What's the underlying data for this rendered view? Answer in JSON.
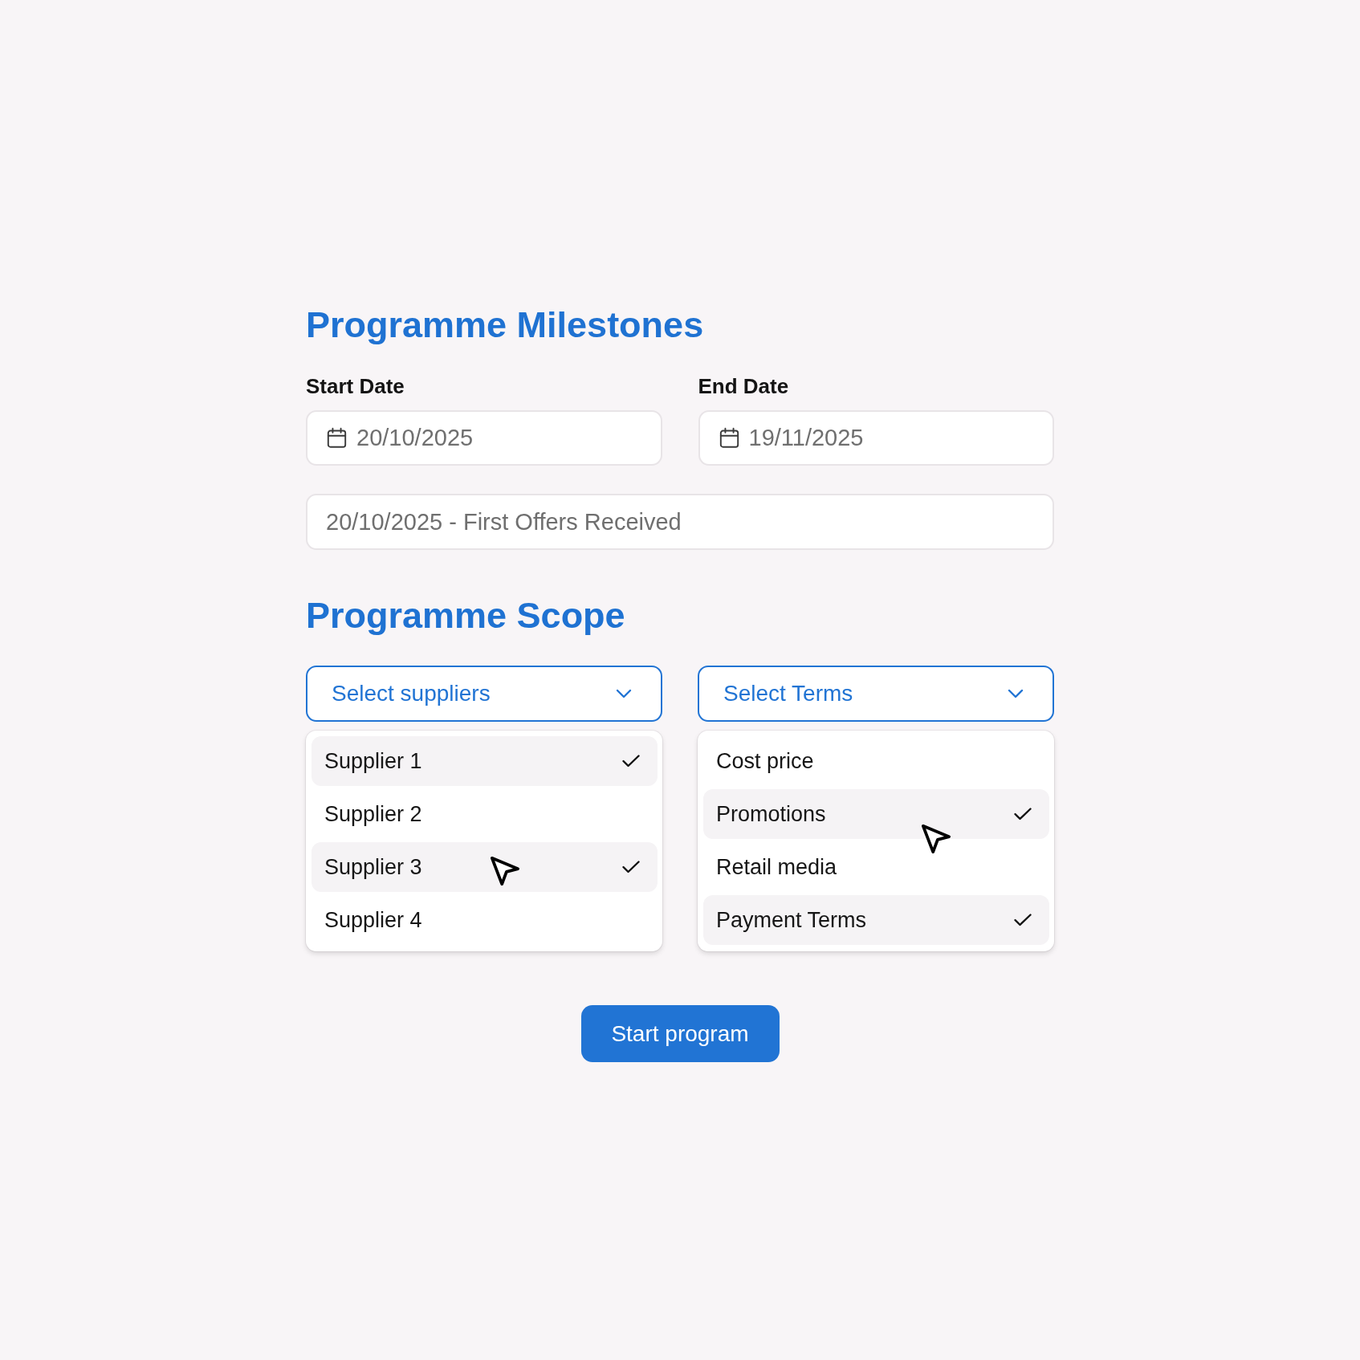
{
  "milestones": {
    "title": "Programme Milestones",
    "dates": [
      {
        "label": "Start Date",
        "value": "20/10/2025"
      },
      {
        "label": "End Date",
        "value": "19/11/2025"
      }
    ],
    "milestone_field": {
      "value": "20/10/2025 - First Offers Received"
    }
  },
  "scope": {
    "title": "Programme Scope",
    "dropdowns": [
      {
        "label": "Select suppliers",
        "expanded": true,
        "options": [
          {
            "label": "Supplier 1",
            "selected": true
          },
          {
            "label": "Supplier 2",
            "selected": false
          },
          {
            "label": "Supplier 3",
            "selected": true
          },
          {
            "label": "Supplier 4",
            "selected": false
          }
        ]
      },
      {
        "label": "Select Terms",
        "expanded": true,
        "options": [
          {
            "label": "Cost price",
            "selected": false
          },
          {
            "label": "Promotions",
            "selected": true
          },
          {
            "label": "Retail media",
            "selected": false
          },
          {
            "label": "Payment Terms",
            "selected": true
          }
        ]
      }
    ]
  },
  "button": {
    "label": "Start program"
  }
}
